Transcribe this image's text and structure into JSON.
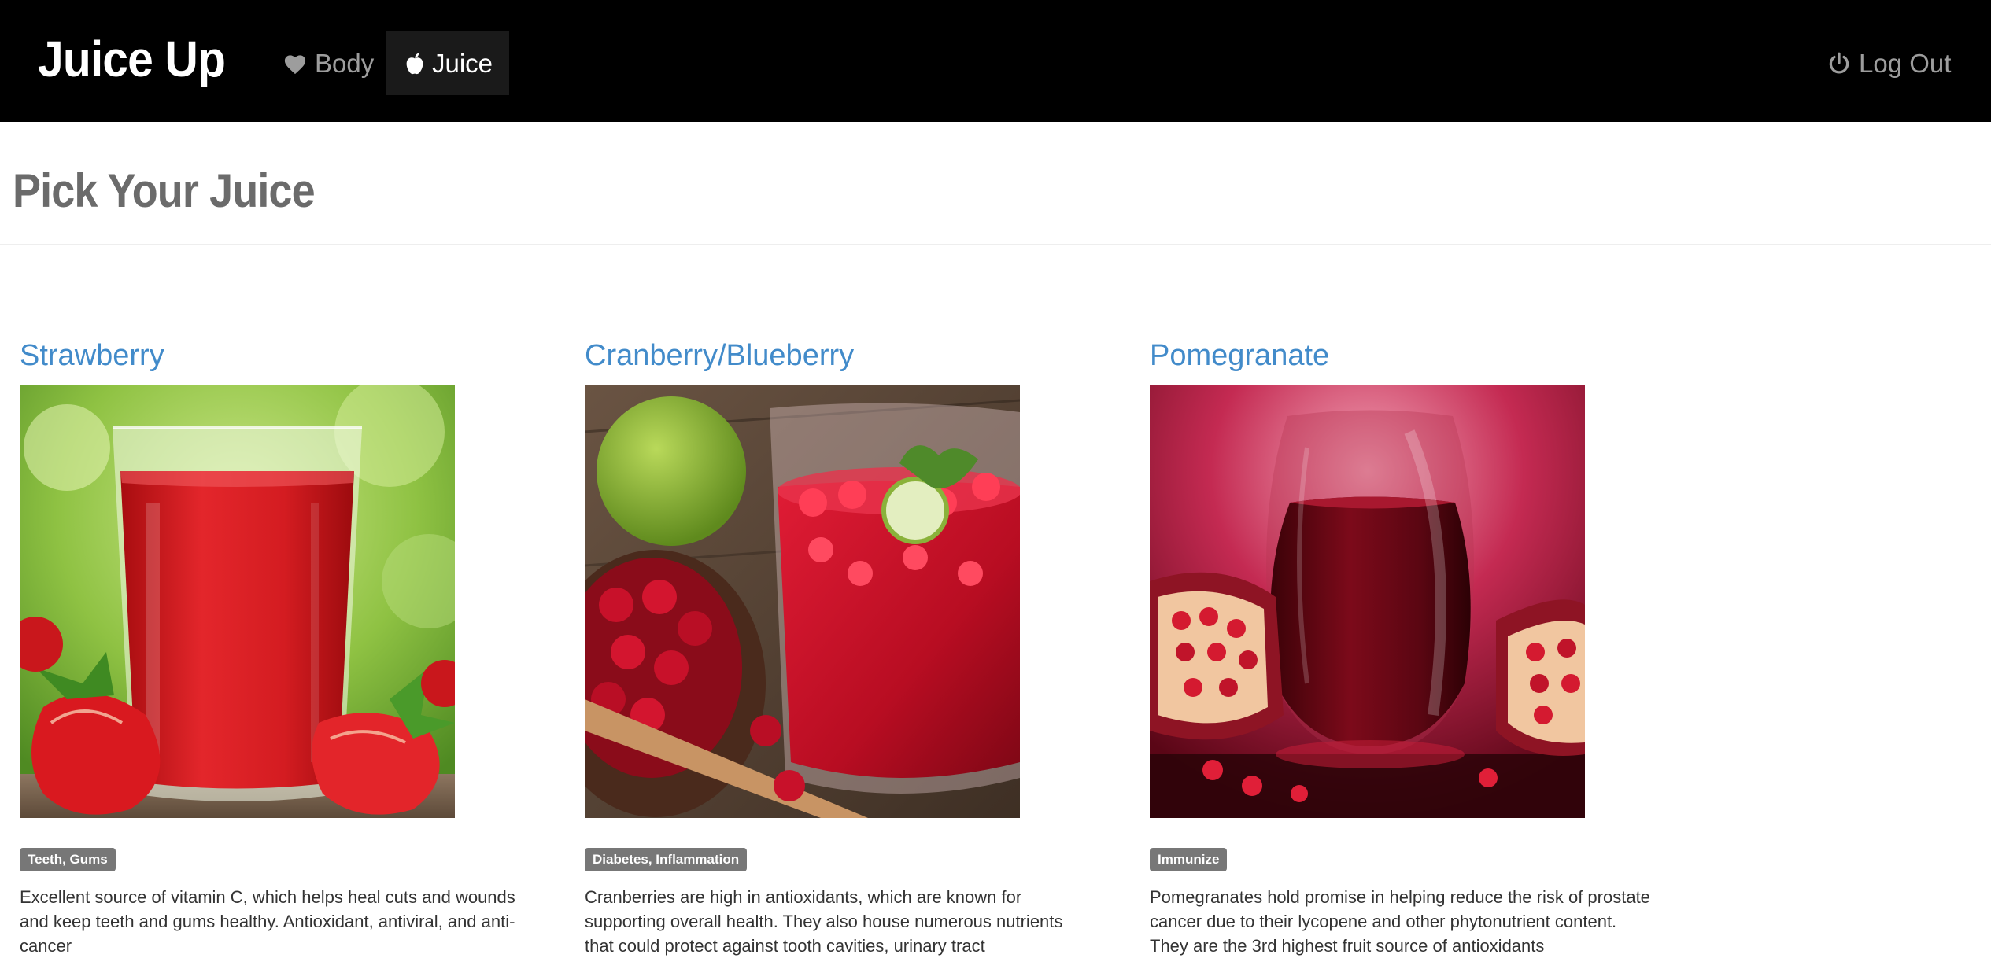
{
  "navbar": {
    "brand": "Juice Up",
    "items": [
      {
        "label": "Body",
        "icon": "heart-icon"
      },
      {
        "label": "Juice",
        "icon": "apple-icon",
        "active": true
      }
    ],
    "logout": {
      "label": "Log Out",
      "icon": "power-icon"
    }
  },
  "header": {
    "title": "Pick Your Juice"
  },
  "colors": {
    "navbar_bg": "#000000",
    "active_item_bg": "#1a1a1a",
    "link": "#428bca",
    "tag_bg": "#777777"
  },
  "juices": [
    {
      "name": "Strawberry",
      "tag": "Teeth, Gums",
      "description": "Excellent source of vitamin C, which helps heal cuts and wounds and keep teeth and gums healthy. Antioxidant, antiviral, and anti-cancer"
    },
    {
      "name": "Cranberry/Blueberry",
      "tag": "Diabetes, Inflammation",
      "description": "Cranberries are high in antioxidants, which are known for supporting overall health. They also house numerous nutrients that could protect against tooth cavities, urinary tract"
    },
    {
      "name": "Pomegranate",
      "tag": "Immunize",
      "description": "Pomegranates hold promise in helping reduce the risk of prostate cancer due to their lycopene and other phytonutrient content. They are the 3rd highest fruit source of antioxidants"
    }
  ]
}
